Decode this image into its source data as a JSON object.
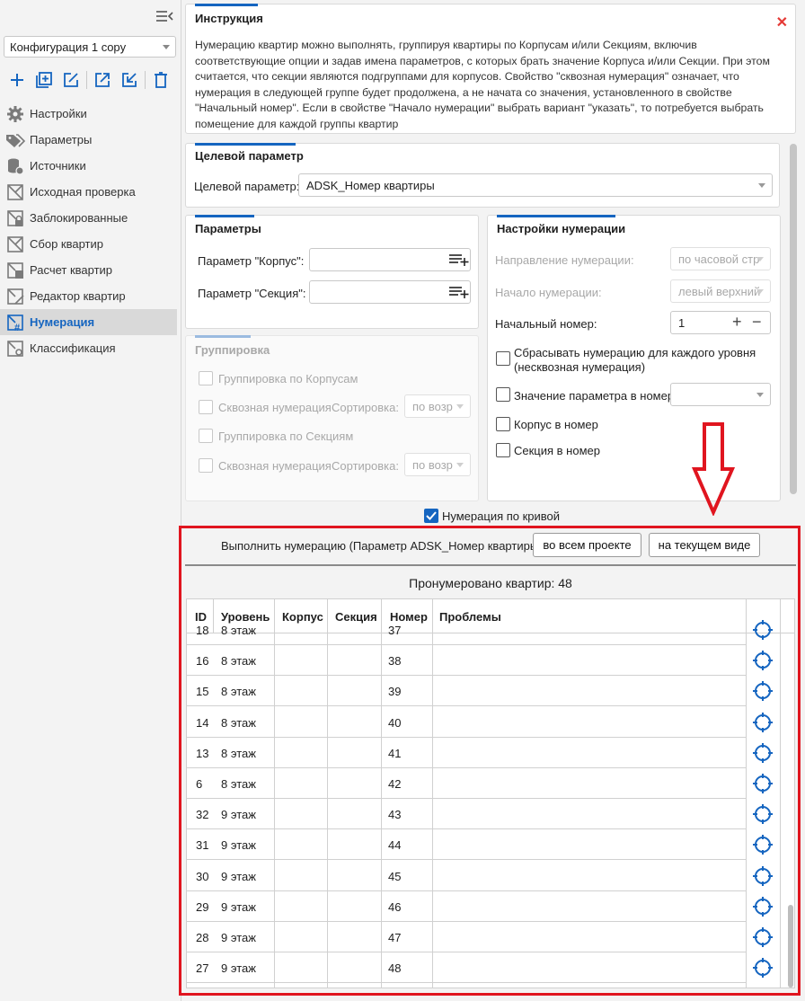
{
  "sidebar": {
    "config_value": "Конфигурация 1 copy",
    "nav": [
      {
        "label": "Настройки",
        "icon": "gear-icon",
        "active": false
      },
      {
        "label": "Параметры",
        "icon": "tags-icon",
        "active": false
      },
      {
        "label": "Источники",
        "icon": "database-icon",
        "active": false
      },
      {
        "label": "Исходная проверка",
        "icon": "room-icon",
        "active": false
      },
      {
        "label": "Заблокированные",
        "icon": "lock-room-icon",
        "active": false
      },
      {
        "label": "Сбор квартир",
        "icon": "room-icon",
        "active": false
      },
      {
        "label": "Расчет квартир",
        "icon": "room-calc-icon",
        "active": false
      },
      {
        "label": "Редактор квартир",
        "icon": "room-edit-icon",
        "active": false
      },
      {
        "label": "Нумерация",
        "icon": "room-number-icon",
        "active": true
      },
      {
        "label": "Классификация",
        "icon": "room-class-icon",
        "active": false
      }
    ]
  },
  "instruction": {
    "title": "Инструкция",
    "text": "Нумерацию квартир можно выполнять, группируя квартиры по Корпусам и/или Секциям, включив соответствующие опции и задав имена параметров, с которых брать значение Корпуса и/или Секции. При этом считается, что секции являются подгруппами для корпусов. Свойство \"сквозная нумерация\" означает, что нумерация в следующей группе будет продолжена, а не начата со значения, установленного в свойстве \"Начальный номер\". Если в свойстве \"Начало нумерации\" выбрать вариант \"указать\", то потребуется выбрать помещение для каждой группы квартир"
  },
  "target": {
    "title": "Целевой параметр",
    "label": "Целевой параметр:",
    "value": "ADSK_Номер квартиры"
  },
  "params": {
    "title": "Параметры",
    "korpus_label": "Параметр \"Корпус\":",
    "section_label": "Параметр \"Секция\":"
  },
  "grouping": {
    "title": "Группировка",
    "by_korpus": "Группировка по Корпусам",
    "through1": "Сквозная нумерация",
    "sort1": "Сортировка:",
    "sort1_value": "по возр",
    "by_section": "Группировка по Секциям",
    "through2": "Сквозная нумерация",
    "sort2": "Сортировка:",
    "sort2_value": "по возр"
  },
  "numbering": {
    "title": "Настройки нумерации",
    "direction_label": "Направление нумерации:",
    "direction_value": "по часовой стр",
    "start_label": "Начало нумерации:",
    "start_value": "левый верхний",
    "start_num_label": "Начальный номер:",
    "start_num_value": "1",
    "reset_label": "Сбрасывать нумерацию для каждого уровня (несквозная нумерация)",
    "param_value_label": "Значение параметра в номер",
    "korpus_in_num": "Корпус в номер",
    "section_in_num": "Секция в номер"
  },
  "curve_label": "Нумерация по кривой",
  "execute": {
    "label": "Выполнить нумерацию (Параметр ADSK_Номер квартиры):",
    "btn_project": "во всем проекте",
    "btn_view": "на текущем виде"
  },
  "result": "Пронумеровано квартир: 48",
  "table": {
    "headers": [
      "ID",
      "Уровень",
      "Корпус",
      "Секция",
      "Номер",
      "Проблемы"
    ],
    "rows": [
      {
        "id": "18",
        "level": "8 этаж",
        "korpus": "",
        "section": "",
        "num": "37",
        "problems": ""
      },
      {
        "id": "16",
        "level": "8 этаж",
        "korpus": "",
        "section": "",
        "num": "38",
        "problems": ""
      },
      {
        "id": "15",
        "level": "8 этаж",
        "korpus": "",
        "section": "",
        "num": "39",
        "problems": ""
      },
      {
        "id": "14",
        "level": "8 этаж",
        "korpus": "",
        "section": "",
        "num": "40",
        "problems": ""
      },
      {
        "id": "13",
        "level": "8 этаж",
        "korpus": "",
        "section": "",
        "num": "41",
        "problems": ""
      },
      {
        "id": "6",
        "level": "8 этаж",
        "korpus": "",
        "section": "",
        "num": "42",
        "problems": ""
      },
      {
        "id": "32",
        "level": "9 этаж",
        "korpus": "",
        "section": "",
        "num": "43",
        "problems": ""
      },
      {
        "id": "31",
        "level": "9 этаж",
        "korpus": "",
        "section": "",
        "num": "44",
        "problems": ""
      },
      {
        "id": "30",
        "level": "9 этаж",
        "korpus": "",
        "section": "",
        "num": "45",
        "problems": ""
      },
      {
        "id": "29",
        "level": "9 этаж",
        "korpus": "",
        "section": "",
        "num": "46",
        "problems": ""
      },
      {
        "id": "28",
        "level": "9 этаж",
        "korpus": "",
        "section": "",
        "num": "47",
        "problems": ""
      },
      {
        "id": "27",
        "level": "9 этаж",
        "korpus": "",
        "section": "",
        "num": "48",
        "problems": ""
      }
    ]
  },
  "colors": {
    "accent": "#1565c0",
    "highlight": "#e0151f"
  }
}
